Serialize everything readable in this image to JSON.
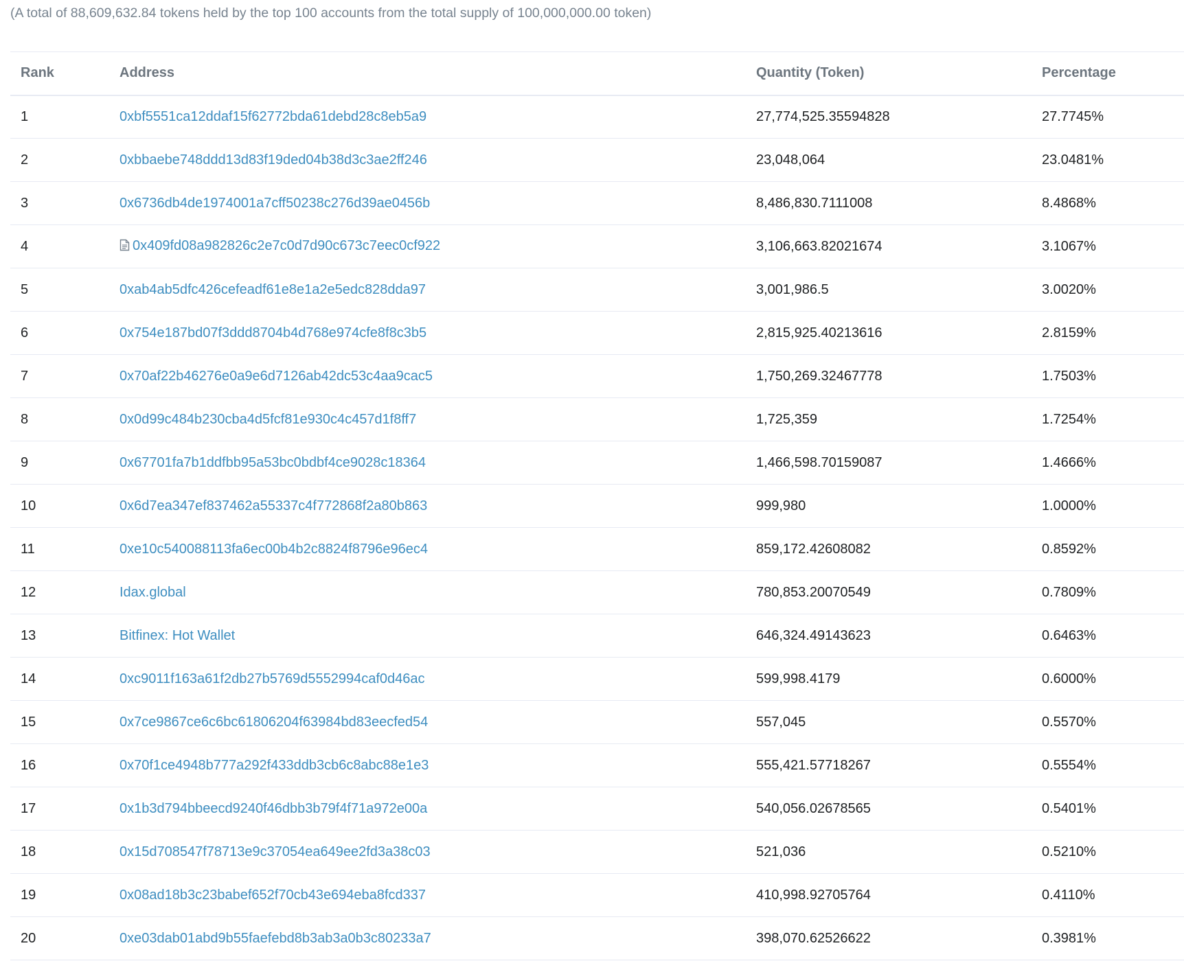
{
  "summary": "(A total of 88,609,632.84 tokens held by the top 100 accounts from the total supply of 100,000,000.00 token)",
  "table": {
    "headers": {
      "rank": "Rank",
      "address": "Address",
      "quantity": "Quantity (Token)",
      "percentage": "Percentage"
    },
    "rows": [
      {
        "rank": "1",
        "address": "0xbf5551ca12ddaf15f62772bda61debd28c8eb5a9",
        "quantity": "27,774,525.35594828",
        "percentage": "27.7745%",
        "icon": ""
      },
      {
        "rank": "2",
        "address": "0xbbaebe748ddd13d83f19ded04b38d3c3ae2ff246",
        "quantity": "23,048,064",
        "percentage": "23.0481%",
        "icon": ""
      },
      {
        "rank": "3",
        "address": "0x6736db4de1974001a7cff50238c276d39ae0456b",
        "quantity": "8,486,830.7111008",
        "percentage": "8.4868%",
        "icon": ""
      },
      {
        "rank": "4",
        "address": "0x409fd08a982826c2e7c0d7d90c673c7eec0cf922",
        "quantity": "3,106,663.82021674",
        "percentage": "3.1067%",
        "icon": "contract-icon"
      },
      {
        "rank": "5",
        "address": "0xab4ab5dfc426cefeadf61e8e1a2e5edc828dda97",
        "quantity": "3,001,986.5",
        "percentage": "3.0020%",
        "icon": ""
      },
      {
        "rank": "6",
        "address": "0x754e187bd07f3ddd8704b4d768e974cfe8f8c3b5",
        "quantity": "2,815,925.40213616",
        "percentage": "2.8159%",
        "icon": ""
      },
      {
        "rank": "7",
        "address": "0x70af22b46276e0a9e6d7126ab42dc53c4aa9cac5",
        "quantity": "1,750,269.32467778",
        "percentage": "1.7503%",
        "icon": ""
      },
      {
        "rank": "8",
        "address": "0x0d99c484b230cba4d5fcf81e930c4c457d1f8ff7",
        "quantity": "1,725,359",
        "percentage": "1.7254%",
        "icon": ""
      },
      {
        "rank": "9",
        "address": "0x67701fa7b1ddfbb95a53bc0bdbf4ce9028c18364",
        "quantity": "1,466,598.70159087",
        "percentage": "1.4666%",
        "icon": ""
      },
      {
        "rank": "10",
        "address": "0x6d7ea347ef837462a55337c4f772868f2a80b863",
        "quantity": "999,980",
        "percentage": "1.0000%",
        "icon": ""
      },
      {
        "rank": "11",
        "address": "0xe10c540088113fa6ec00b4b2c8824f8796e96ec4",
        "quantity": "859,172.42608082",
        "percentage": "0.8592%",
        "icon": ""
      },
      {
        "rank": "12",
        "address": "Idax.global",
        "quantity": "780,853.20070549",
        "percentage": "0.7809%",
        "icon": ""
      },
      {
        "rank": "13",
        "address": "Bitfinex: Hot Wallet",
        "quantity": "646,324.49143623",
        "percentage": "0.6463%",
        "icon": ""
      },
      {
        "rank": "14",
        "address": "0xc9011f163a61f2db27b5769d5552994caf0d46ac",
        "quantity": "599,998.4179",
        "percentage": "0.6000%",
        "icon": ""
      },
      {
        "rank": "15",
        "address": "0x7ce9867ce6c6bc61806204f63984bd83eecfed54",
        "quantity": "557,045",
        "percentage": "0.5570%",
        "icon": ""
      },
      {
        "rank": "16",
        "address": "0x70f1ce4948b777a292f433ddb3cb6c8abc88e1e3",
        "quantity": "555,421.57718267",
        "percentage": "0.5554%",
        "icon": ""
      },
      {
        "rank": "17",
        "address": "0x1b3d794bbeecd9240f46dbb3b79f4f71a972e00a",
        "quantity": "540,056.02678565",
        "percentage": "0.5401%",
        "icon": ""
      },
      {
        "rank": "18",
        "address": "0x15d708547f78713e9c37054ea649ee2fd3a38c03",
        "quantity": "521,036",
        "percentage": "0.5210%",
        "icon": ""
      },
      {
        "rank": "19",
        "address": "0x08ad18b3c23babef652f70cb43e694eba8fcd337",
        "quantity": "410,998.92705764",
        "percentage": "0.4110%",
        "icon": ""
      },
      {
        "rank": "20",
        "address": "0xe03dab01abd9b55faefebd8b3ab3a0b3c80233a7",
        "quantity": "398,070.62526622",
        "percentage": "0.3981%",
        "icon": ""
      }
    ]
  },
  "colors": {
    "link": "#3e8ec0",
    "muted_text": "#77838f",
    "header_text": "#6c757e",
    "border": "#e7eaf3"
  }
}
